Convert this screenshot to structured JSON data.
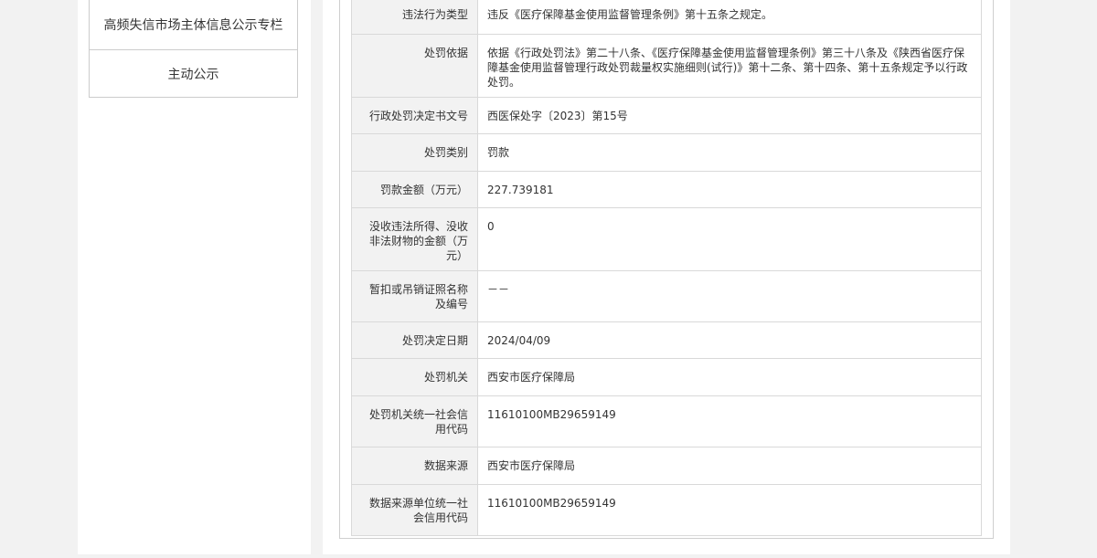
{
  "sidebar": {
    "items": [
      {
        "label": "高频失信市场主体信息公示专栏"
      },
      {
        "label": "主动公示"
      }
    ]
  },
  "detail": {
    "rows": [
      {
        "label": "违法行为类型",
        "value": "违反《医疗保障基金使用监督管理条例》第十五条之规定。"
      },
      {
        "label": "处罚依据",
        "value": "依据《行政处罚法》第二十八条、《医疗保障基金使用监督管理条例》第三十八条及《陕西省医疗保障基金使用监督管理行政处罚裁量权实施细则(试行)》第十二条、第十四条、第十五条规定予以行政处罚。"
      },
      {
        "label": "行政处罚决定书文号",
        "value": "西医保处字〔2023〕第15号"
      },
      {
        "label": "处罚类别",
        "value": "罚款"
      },
      {
        "label": "罚款金额（万元）",
        "value": "227.739181"
      },
      {
        "label": "没收违法所得、没收非法财物的金额（万元）",
        "value": "0"
      },
      {
        "label": "暂扣或吊销证照名称及编号",
        "value": "－－"
      },
      {
        "label": "处罚决定日期",
        "value": "2024/04/09"
      },
      {
        "label": "处罚机关",
        "value": "西安市医疗保障局"
      },
      {
        "label": "处罚机关统一社会信用代码",
        "value": "11610100MB29659149"
      },
      {
        "label": "数据来源",
        "value": "西安市医疗保障局"
      },
      {
        "label": "数据来源单位统一社会信用代码",
        "value": "11610100MB29659149"
      }
    ]
  }
}
